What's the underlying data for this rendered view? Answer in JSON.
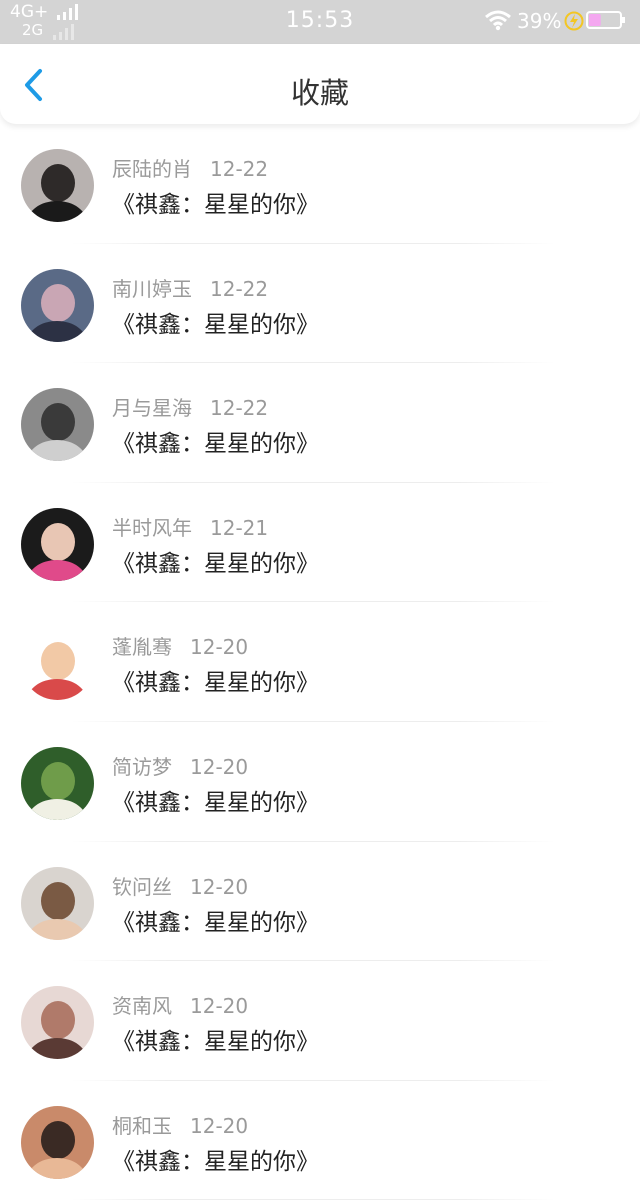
{
  "status_bar": {
    "network_top": "4G+",
    "network_bottom": "2G",
    "time": "15:53",
    "battery_percent": "39%",
    "icons": [
      "signal-icon",
      "wifi-icon",
      "charging-bolt-icon",
      "battery-icon"
    ],
    "battery_level": 0.39
  },
  "header": {
    "title": "收藏",
    "back_icon": "chevron-left-icon",
    "accent_color": "#1e9be6"
  },
  "items": [
    {
      "name": "辰陆的肖",
      "date": "12-22",
      "book": "《祺鑫：星星的你》",
      "avatar_colors": [
        "#b8b2b0",
        "#2e2a29",
        "#1a1a1a"
      ]
    },
    {
      "name": "南川婷玉",
      "date": "12-22",
      "book": "《祺鑫：星星的你》",
      "avatar_colors": [
        "#5a6a86",
        "#c9a6b4",
        "#2c3144"
      ]
    },
    {
      "name": "月与星海",
      "date": "12-22",
      "book": "《祺鑫：星星的你》",
      "avatar_colors": [
        "#8a8a8a",
        "#3a3a3a",
        "#cfcfcf"
      ]
    },
    {
      "name": "半时风年",
      "date": "12-21",
      "book": "《祺鑫：星星的你》",
      "avatar_colors": [
        "#1b1b1b",
        "#e8c6b4",
        "#e04a8a"
      ]
    },
    {
      "name": "蓬胤骞",
      "date": "12-20",
      "book": "《祺鑫：星星的你》",
      "avatar_colors": [
        "#ffffff",
        "#f2c9a6",
        "#d94a4a"
      ]
    },
    {
      "name": "简访梦",
      "date": "12-20",
      "book": "《祺鑫：星星的你》",
      "avatar_colors": [
        "#2f5e2a",
        "#6f9c4a",
        "#f0f0e4"
      ]
    },
    {
      "name": "钦问丝",
      "date": "12-20",
      "book": "《祺鑫：星星的你》",
      "avatar_colors": [
        "#d9d4cf",
        "#7a5a44",
        "#e9c9b0"
      ]
    },
    {
      "name": "资南风",
      "date": "12-20",
      "book": "《祺鑫：星星的你》",
      "avatar_colors": [
        "#e7d8d4",
        "#b07a6a",
        "#5a3a34"
      ]
    },
    {
      "name": "桐和玉",
      "date": "12-20",
      "book": "《祺鑫：星星的你》",
      "avatar_colors": [
        "#c98a6a",
        "#3a2a24",
        "#e8b896"
      ]
    }
  ]
}
